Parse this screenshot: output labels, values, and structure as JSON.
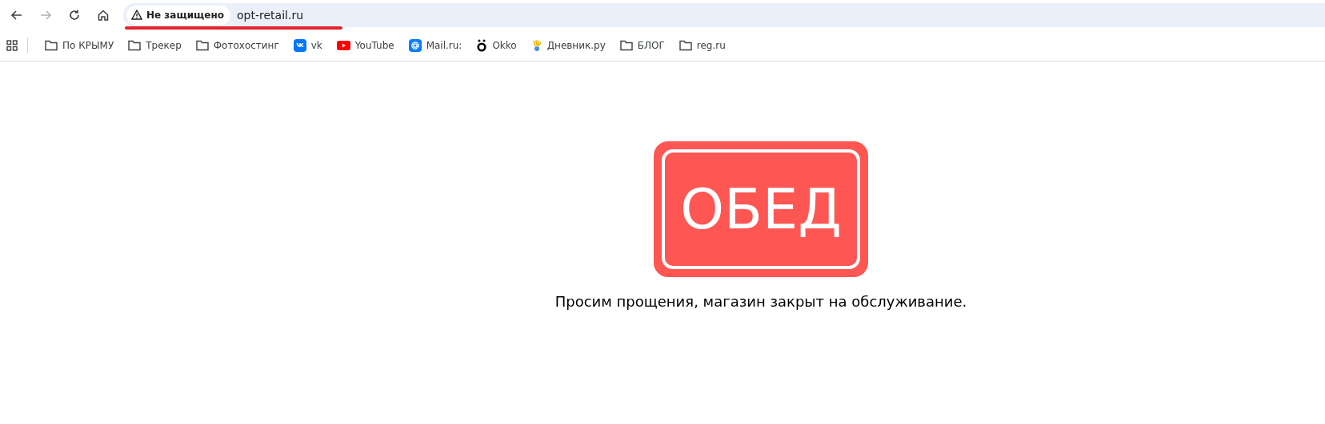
{
  "toolbar": {
    "buttons": [
      {
        "kind": "back",
        "disabled": false
      },
      {
        "kind": "forward",
        "disabled": true
      },
      {
        "kind": "reload",
        "disabled": false
      },
      {
        "kind": "home",
        "disabled": false
      }
    ],
    "address_bar": {
      "security_label": "Не защищено",
      "url": "opt-retail.ru",
      "underlined": true
    }
  },
  "bookmarks_bar": {
    "items": [
      {
        "kind": "folder",
        "label": "По КРЫМУ"
      },
      {
        "kind": "folder",
        "label": "Трекер"
      },
      {
        "kind": "folder",
        "label": "Фотохостинг"
      },
      {
        "kind": "vk",
        "label": "vk"
      },
      {
        "kind": "youtube",
        "label": "YouTube"
      },
      {
        "kind": "mail",
        "label": "Mail.ru:"
      },
      {
        "kind": "okko",
        "label": "Okko"
      },
      {
        "kind": "hand",
        "label": "Дневник.ру"
      },
      {
        "kind": "folder",
        "label": "БЛОГ"
      },
      {
        "kind": "folder",
        "label": "reg.ru"
      }
    ]
  },
  "page": {
    "sign": "ОБЕД",
    "message": "Просим прощения, магазин закрыт на обслуживание."
  }
}
